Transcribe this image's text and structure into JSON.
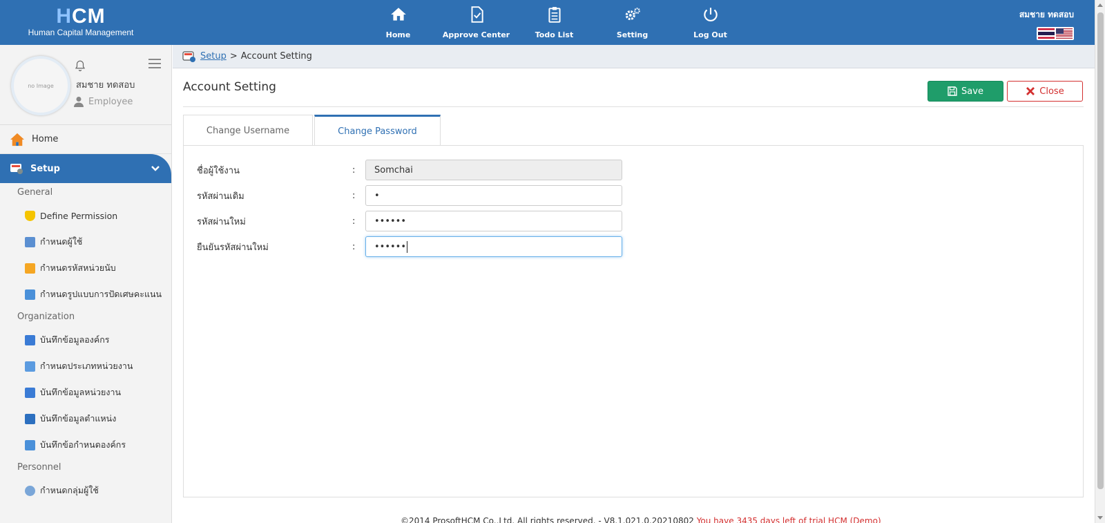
{
  "brand": {
    "logo_h": "H",
    "logo_cm": "CM",
    "subtitle": "Human Capital Management"
  },
  "topnav": [
    {
      "label": "Home",
      "icon": "home-icon"
    },
    {
      "label": "Approve Center",
      "icon": "approve-icon"
    },
    {
      "label": "Todo List",
      "icon": "clipboard-icon"
    },
    {
      "label": "Setting",
      "icon": "gears-icon"
    },
    {
      "label": "Log Out",
      "icon": "power-icon"
    }
  ],
  "user": {
    "name": "สมชาย ทดสอบ",
    "role": "Employee",
    "avatar_text": "no Image"
  },
  "sidebar": {
    "home": "Home",
    "setup": "Setup",
    "sections": [
      {
        "title": "General",
        "items": [
          "Define Permission",
          "กำหนดผู้ใช้",
          "กำหนดรหัสหน่วยนับ",
          "กำหนดรูปแบบการปัดเศษคะแนน"
        ]
      },
      {
        "title": "Organization",
        "items": [
          "บันทึกข้อมูลองค์กร",
          "กำหนดประเภทหน่วยงาน",
          "บันทึกข้อมูลหน่วยงาน",
          "บันทึกข้อมูลตำแหน่ง",
          "บันทึกข้อกำหนดองค์กร"
        ]
      },
      {
        "title": "Personnel",
        "items": [
          "กำหนดกลุ่มผู้ใช้"
        ]
      }
    ]
  },
  "breadcrumb": {
    "link": "Setup",
    "sep": ">",
    "current": "Account Setting"
  },
  "page": {
    "title": "Account Setting",
    "save": "Save",
    "close": "Close"
  },
  "tabs": [
    "Change Username",
    "Change Password"
  ],
  "form": {
    "colon": ":",
    "username_label": "ชื่อผู้ใช้งาน",
    "username_value": "Somchai",
    "old_pw_label": "รหัสผ่านเดิม",
    "old_pw_value": "•",
    "new_pw_label": "รหัสผ่านใหม่",
    "new_pw_value": "••••••",
    "confirm_pw_label": "ยืนยันรหัสผ่านใหม่",
    "confirm_pw_value": "••••••"
  },
  "footer": {
    "copyright": "©2014 ProsoftHCM Co.,Ltd. All rights reserved. - V8.1.021.0.20210802",
    "trial": "You have 3435 days left of trial HCM (Demo)"
  },
  "colors": {
    "primary": "#2f70b3",
    "save": "#1f9d6a",
    "danger": "#d32f2f"
  }
}
